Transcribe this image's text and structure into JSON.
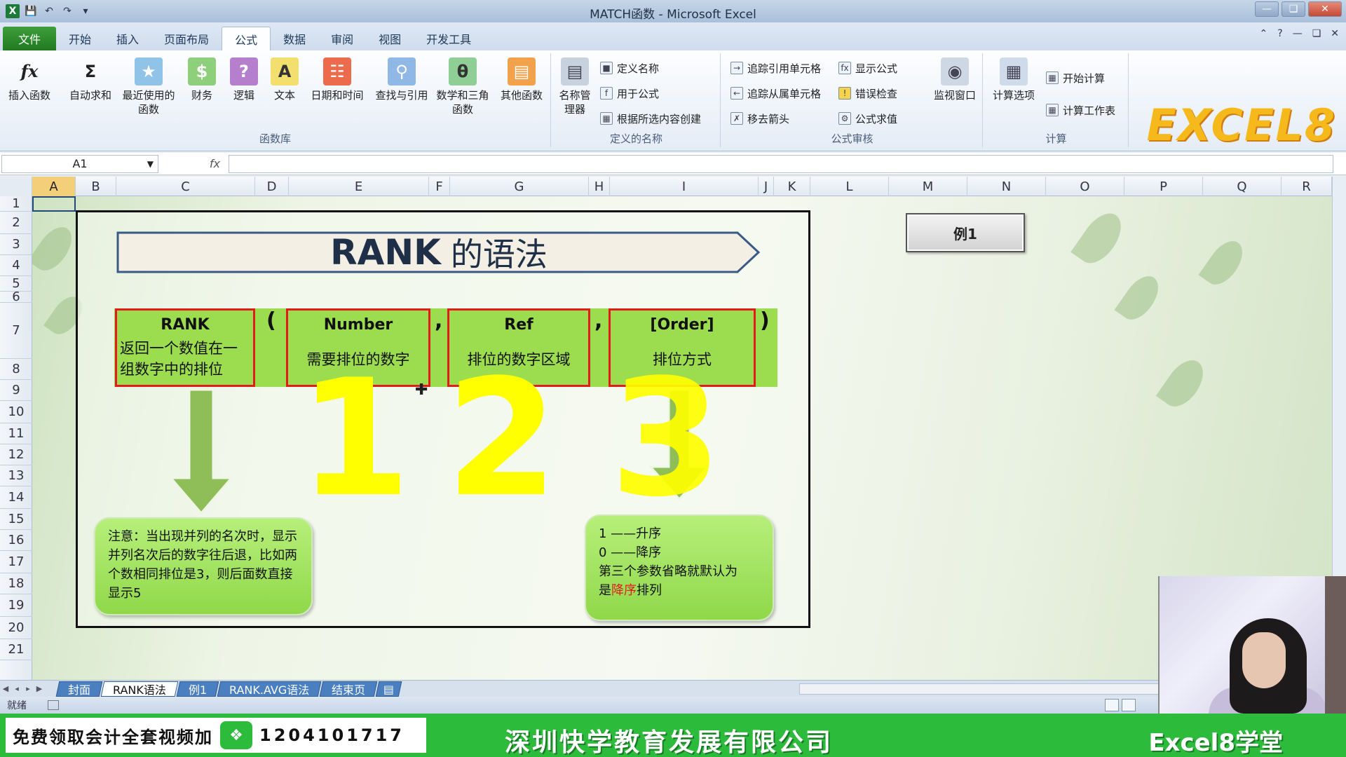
{
  "window": {
    "title": "MATCH函数 - Microsoft Excel",
    "app_icon": "X",
    "quick_access": [
      "save-icon",
      "undo-icon",
      "redo-icon",
      "customize-icon"
    ],
    "controls": [
      "minimize-icon",
      "restore-icon",
      "close-icon"
    ]
  },
  "ribbon_tabs": [
    "文件",
    "开始",
    "插入",
    "页面布局",
    "公式",
    "数据",
    "审阅",
    "视图",
    "开发工具"
  ],
  "active_tab": "公式",
  "ribbon": {
    "function_library": {
      "label": "函数库",
      "buttons": [
        "插入函数",
        "自动求和",
        "最近使用的函数",
        "财务",
        "逻辑",
        "文本",
        "日期和时间",
        "查找与引用",
        "数学和三角函数",
        "其他函数"
      ]
    },
    "defined_names": {
      "label": "定义的名称",
      "big": "名称管理器",
      "small": [
        "定义名称",
        "用于公式",
        "根据所选内容创建"
      ]
    },
    "formula_auditing": {
      "label": "公式审核",
      "small": [
        "追踪引用单元格",
        "显示公式",
        "追踪从属单元格",
        "错误检查",
        "移去箭头",
        "公式求值"
      ],
      "big": "监视窗口"
    },
    "calculation": {
      "label": "计算",
      "big": "计算选项",
      "small": [
        "开始计算",
        "计算工作表"
      ]
    },
    "brand": "EXCEL8"
  },
  "formula_bar": {
    "name_box": "A1",
    "fx": "fx",
    "value": ""
  },
  "columns": [
    "A",
    "B",
    "C",
    "D",
    "E",
    "F",
    "G",
    "H",
    "I",
    "J",
    "K",
    "L",
    "M",
    "N",
    "O",
    "P",
    "Q",
    "R"
  ],
  "rows": [
    "1",
    "2",
    "3",
    "4",
    "5",
    "6",
    "7",
    "8",
    "9",
    "10",
    "11",
    "12",
    "13",
    "14",
    "15",
    "16",
    "17",
    "18",
    "19",
    "20",
    "21"
  ],
  "diagram": {
    "title_en": "RANK",
    "title_zh": "的语法",
    "boxes": [
      {
        "title": "RANK",
        "desc": "返回一个数值在一组数字中的排位"
      },
      {
        "title": "Number",
        "desc": "需要排位的数字"
      },
      {
        "title": "Ref",
        "desc": "排位的数字区域"
      },
      {
        "title": "[Order]",
        "desc": "排位方式"
      }
    ],
    "punct": [
      "(",
      ",",
      ",",
      ")"
    ],
    "big_numbers": [
      "1",
      "2",
      "3"
    ],
    "note_left": "注意：当出现并列的名次时，显示并列名次后的数字往后退，比如两个数相同排位是3，则后面数直接显示5",
    "note_right": {
      "line1": "1 ——升序",
      "line2": "0 ——降序",
      "line3": "第三个参数省略就默认为",
      "line4_pre": "是",
      "line4_red": "降序",
      "line4_post": "排列"
    },
    "red_color": "#e21c1c",
    "box_color": "#9cdc4f"
  },
  "example_button": "例1",
  "sheet_tabs": [
    "封面",
    "RANK语法",
    "例1",
    "RANK.AVG语法",
    "结束页"
  ],
  "active_sheet": "RANK语法",
  "status": "就绪",
  "footer": {
    "promo_text": "免费领取会计全套视频加",
    "wechat_icon": "wechat-icon",
    "phone": "1204101717",
    "company": "深圳快学教育发展有限公司",
    "school": "Excel8学堂"
  }
}
